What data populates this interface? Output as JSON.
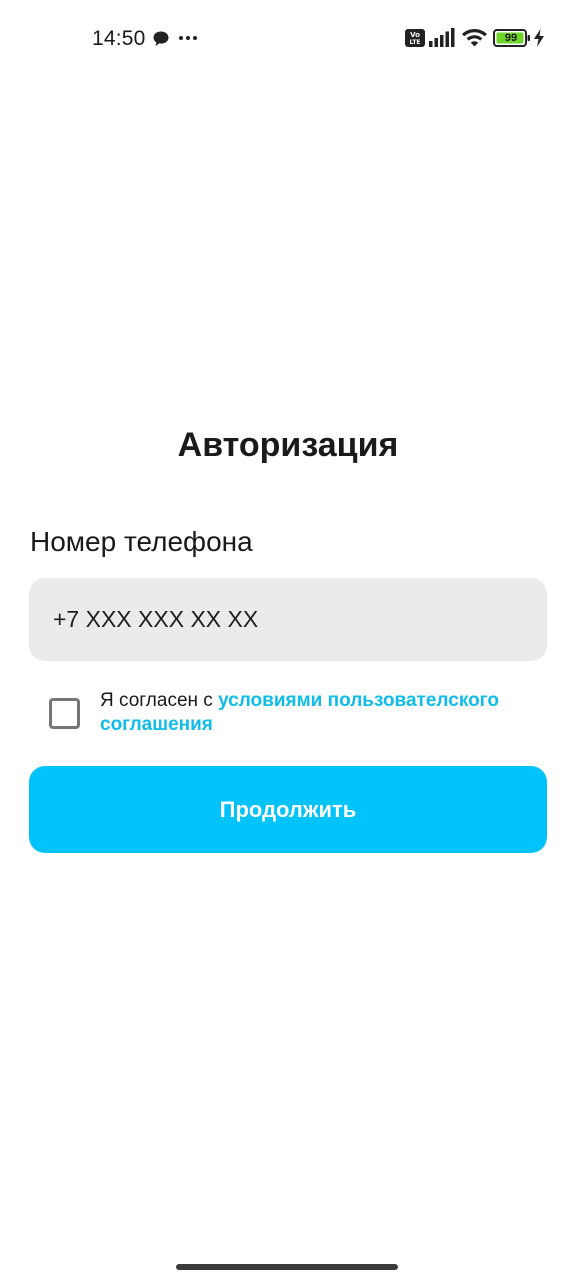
{
  "status_bar": {
    "time": "14:50",
    "battery_level": "99",
    "icons": [
      "chat-bubble-icon",
      "more-dots-icon",
      "volte-icon",
      "signal-icon",
      "wifi-icon",
      "battery-icon",
      "charging-bolt-icon"
    ],
    "battery_color": "#6fd42a"
  },
  "auth": {
    "title": "Авторизация",
    "phone_label": "Номер телефона",
    "phone_placeholder": "+7 XXX XXX XX XX",
    "agree_prefix": "Я согласен с ",
    "agree_link": "условиями пользователского соглашения",
    "continue_label": "Продолжить"
  },
  "colors": {
    "accent": "#00c3fb",
    "link": "#10bdea",
    "field_bg": "#ebebeb"
  }
}
